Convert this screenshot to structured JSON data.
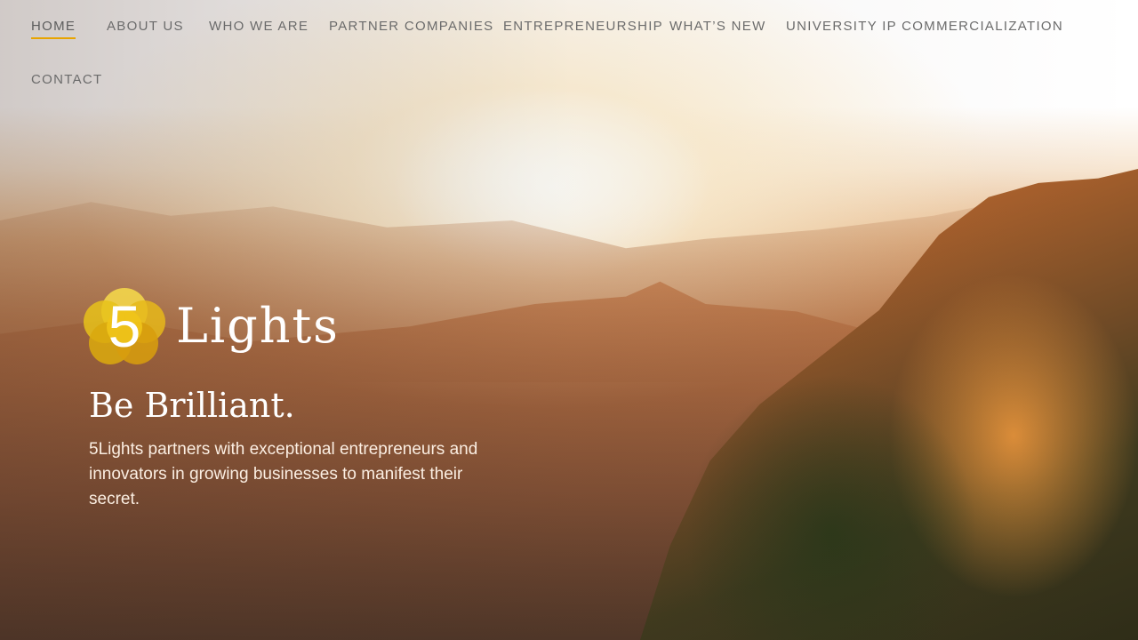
{
  "nav": {
    "items": [
      {
        "label": "HOME",
        "active": true
      },
      {
        "label": "ABOUT US",
        "active": false
      },
      {
        "label": "WHO WE ARE",
        "active": false
      },
      {
        "label": "PARTNER COMPANIES",
        "active": false
      },
      {
        "label": "ENTREPRENEURSHIP",
        "active": false
      },
      {
        "label": "WHAT’S NEW",
        "active": false
      },
      {
        "label": "UNIVERSITY IP COMMERCIALIZATION",
        "active": false
      },
      {
        "label": "CONTACT",
        "active": false
      }
    ]
  },
  "hero": {
    "logo_numeral": "5",
    "brand_name": "Lights",
    "tagline": "Be Brilliant.",
    "description": "5Lights partners with exceptional entrepreneurs and innovators in growing businesses to manifest their secret."
  },
  "colors": {
    "accent": "#e8a400",
    "logo_yellow": "#f0c419",
    "nav_text": "#6b6b6b",
    "hero_text": "#ffffff"
  },
  "icons": {
    "logo": "five-circles-logo"
  }
}
